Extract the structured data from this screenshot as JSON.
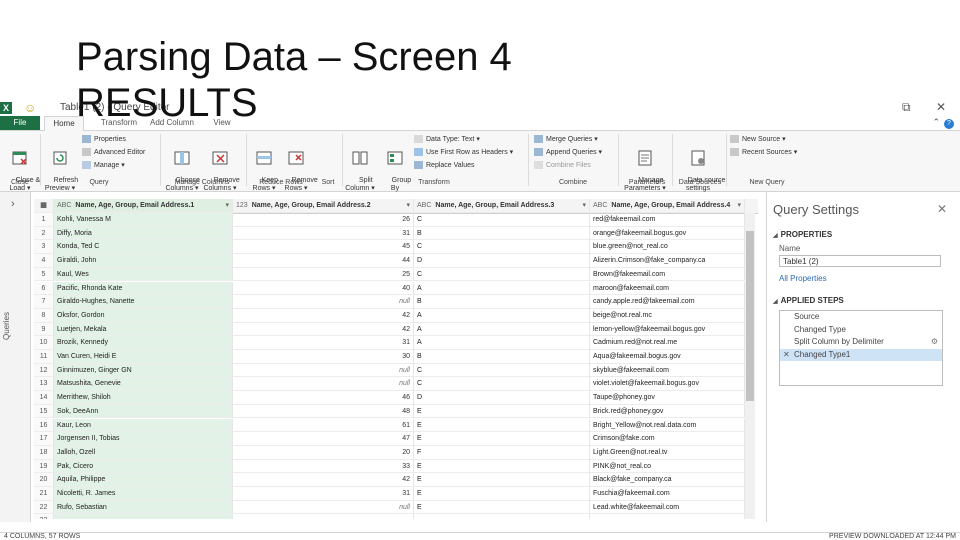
{
  "slide": {
    "title_line1": "Parsing Data – Screen 4",
    "title_line2": "RESULTS"
  },
  "window": {
    "title": "Table1 (2) - Query Editor",
    "app_icon": "X"
  },
  "tabs": [
    "File",
    "Home",
    "Transform",
    "Add Column",
    "View"
  ],
  "ribbon": {
    "close_load": "Close &\nLoad ▾",
    "refresh_preview": "Refresh\nPreview ▾",
    "properties": "Properties",
    "advanced_editor": "Advanced Editor",
    "manage": "Manage ▾",
    "choose_columns": "Choose\nColumns ▾",
    "remove_columns": "Remove\nColumns ▾",
    "keep_rows": "Keep\nRows ▾",
    "remove_rows": "Remove\nRows ▾",
    "split_column": "Split\nColumn ▾",
    "group_by": "Group\nBy",
    "data_type": "Data Type: Text ▾",
    "use_first_row": "Use First Row as Headers ▾",
    "replace_values": "Replace Values",
    "merge_queries": "Merge Queries ▾",
    "append_queries": "Append Queries ▾",
    "combine_files": "Combine Files",
    "manage_parameters": "Manage\nParameters ▾",
    "data_source_settings": "Data source\nsettings",
    "new_source": "New Source ▾",
    "recent_sources": "Recent Sources ▾",
    "groups": {
      "close": "Close",
      "query": "Query",
      "manage_columns": "Manage Columns",
      "reduce_rows": "Reduce Rows",
      "sort": "Sort",
      "transform": "Transform",
      "combine": "Combine",
      "parameters": "Parameters",
      "data_sources": "Data Sources",
      "new_query": "New Query"
    }
  },
  "queries_label": "Queries",
  "table": {
    "headers": [
      {
        "type": "ABC",
        "label": "Name, Age, Group, Email Address.1"
      },
      {
        "type": "123",
        "label": "Name, Age, Group, Email Address.2"
      },
      {
        "type": "ABC",
        "label": "Name, Age, Group, Email Address.3"
      },
      {
        "type": "ABC",
        "label": "Name, Age, Group, Email Address.4"
      }
    ],
    "rows": [
      [
        "1",
        "Kohli, Vanessa M",
        "26",
        "C",
        "red@fakeemail.com"
      ],
      [
        "2",
        "Diffy, Moria",
        "31",
        "B",
        "orange@fakeemail.bogus.gov"
      ],
      [
        "3",
        "Konda, Ted C",
        "45",
        "C",
        "blue.green@not_real.co"
      ],
      [
        "4",
        "Giraldi, John",
        "44",
        "D",
        "Alizerin.Crimson@fake_company.ca"
      ],
      [
        "5",
        "Kaul, Wes",
        "25",
        "C",
        "Brown@fakeemail.com"
      ],
      [
        "6",
        "Pacific, Rhonda Kate",
        "40",
        "A",
        "maroon@fakeemail.com"
      ],
      [
        "7",
        "Giraldo-Hughes, Nanette",
        "null",
        "B",
        "candy.apple.red@fakeemail.com"
      ],
      [
        "8",
        "Oksfor, Gordon",
        "42",
        "A",
        "beige@not.real.mc"
      ],
      [
        "9",
        "Luetjen, Mekala",
        "42",
        "A",
        "lemon-yellow@fakeemail.bogus.gov"
      ],
      [
        "10",
        "Brozik, Kennedy",
        "31",
        "A",
        "Cadmium.red@not.real.me"
      ],
      [
        "11",
        "Van Curen, Heidi E",
        "30",
        "B",
        "Aqua@fakeemail.bogus.gov"
      ],
      [
        "12",
        "Ginnimuzen, Ginger GN",
        "null",
        "C",
        "skyblue@fakeemail.com"
      ],
      [
        "13",
        "Matsushita, Genevie",
        "null",
        "C",
        "violet.violet@fakeemail.bogus.gov"
      ],
      [
        "14",
        "Merrithew, Shiloh",
        "46",
        "D",
        "Taupe@phoney.gov"
      ],
      [
        "15",
        "Sok, DeeAnn",
        "48",
        "E",
        "Brick.red@phoney.gov"
      ],
      [
        "16",
        "Kaur, Leon",
        "61",
        "E",
        "Bright_Yellow@not.real.data.com"
      ],
      [
        "17",
        "Jorgensen II, Tobias",
        "47",
        "E",
        "Crimson@fake.com"
      ],
      [
        "18",
        "Jalloh, Ozell",
        "20",
        "F",
        "Light.Green@not.real.tv"
      ],
      [
        "19",
        "Pak, Cicero",
        "33",
        "E",
        "PINK@not_real.co"
      ],
      [
        "20",
        "Aquila, Philippe",
        "42",
        "E",
        "Black@fake_company.ca"
      ],
      [
        "21",
        "Nicoletti, R. James",
        "31",
        "E",
        "Fuschia@fakeemail.com"
      ],
      [
        "22",
        "Rufo, Sebastian",
        "null",
        "E",
        "Lead.white@fakeemail.com"
      ],
      [
        "23",
        "",
        "",
        "",
        ""
      ]
    ]
  },
  "settings": {
    "title": "Query Settings",
    "properties_header": "PROPERTIES",
    "name_label": "Name",
    "name_value": "Table1 (2)",
    "all_properties": "All Properties",
    "applied_steps_header": "APPLIED STEPS",
    "steps": [
      "Source",
      "Changed Type",
      "Split Column by Delimiter",
      "Changed Type1"
    ]
  },
  "status": {
    "left": "4 COLUMNS, 57 ROWS",
    "right": "PREVIEW DOWNLOADED AT 12:44 PM"
  }
}
